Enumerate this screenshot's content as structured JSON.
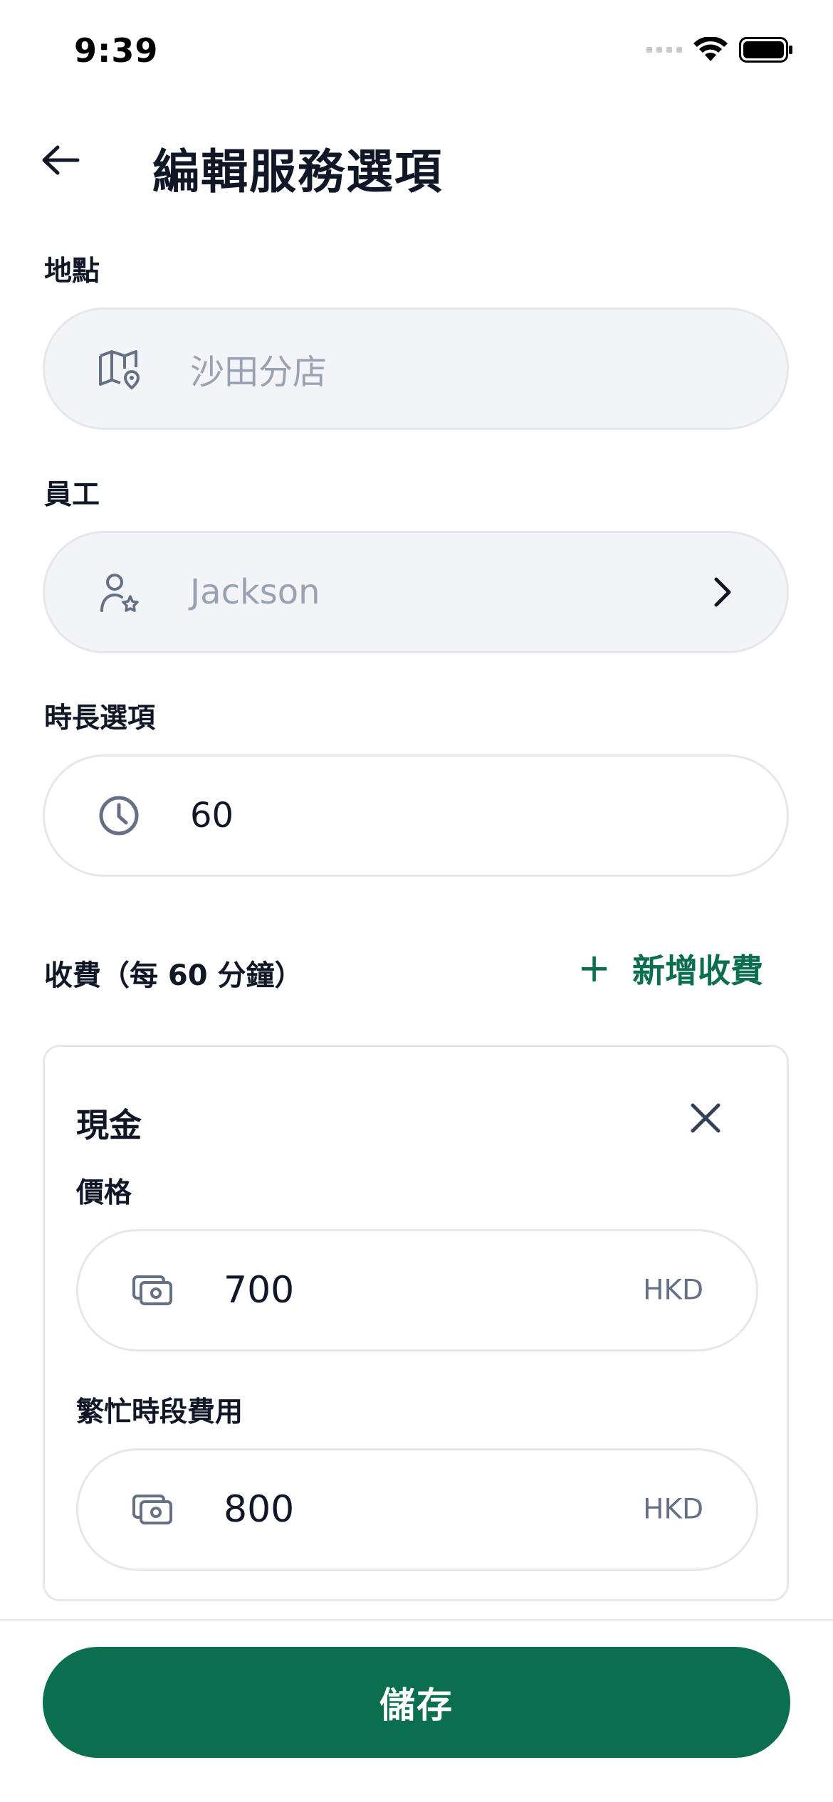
{
  "status_bar": {
    "time": "9:39"
  },
  "header": {
    "title": "編輯服務選項"
  },
  "location": {
    "label": "地點",
    "value": "沙田分店"
  },
  "staff": {
    "label": "員工",
    "value": "Jackson"
  },
  "duration": {
    "label": "時長選項",
    "value": "60"
  },
  "fees": {
    "title": "收費（每 60 分鐘）",
    "add_label": "新增收費",
    "add_icon": "+",
    "card": {
      "title": "現金",
      "price": {
        "label": "價格",
        "value": "700",
        "currency": "HKD"
      },
      "peak": {
        "label": "繁忙時段費用",
        "value": "800",
        "currency": "HKD"
      }
    }
  },
  "footer": {
    "save_label": "儲存"
  },
  "colors": {
    "accent": "#0a6e4f",
    "border": "#e4e7ec",
    "disabled_bg": "#f2f4f7",
    "muted_text": "#98a2b3"
  }
}
